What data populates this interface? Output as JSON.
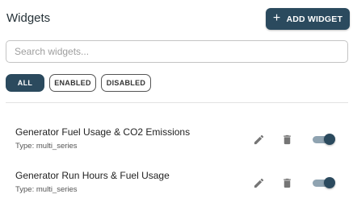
{
  "header": {
    "title": "Widgets",
    "add_button_label": "ADD WIDGET",
    "add_button_icon": "plus-icon"
  },
  "search": {
    "placeholder": "Search widgets...",
    "value": ""
  },
  "filters": {
    "selected": "ALL",
    "items": [
      {
        "label": "ALL",
        "active": true
      },
      {
        "label": "ENABLED",
        "active": false
      },
      {
        "label": "DISABLED",
        "active": false
      }
    ]
  },
  "widgets": [
    {
      "name": "Generator Fuel Usage & CO2 Emissions",
      "type": "Type: multi_series",
      "enabled": true
    },
    {
      "name": "Generator Run Hours & Fuel Usage",
      "type": "Type: multi_series",
      "enabled": true
    }
  ],
  "icons": {
    "edit": "pencil-icon",
    "delete": "trash-icon"
  },
  "colors": {
    "primary": "#2b4a5e",
    "toggle_track": "#8fa3b1",
    "icon_gray": "#757575"
  }
}
